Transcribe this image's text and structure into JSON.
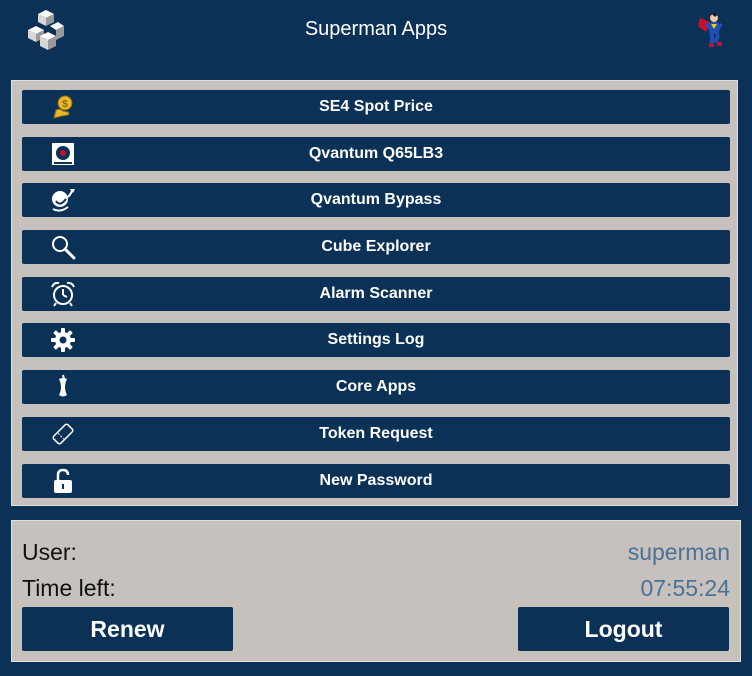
{
  "header": {
    "title": "Superman Apps",
    "logo_icon": "cubes-logo-icon",
    "avatar_icon": "superman-avatar-icon"
  },
  "menu": {
    "items": [
      {
        "label": "SE4 Spot Price",
        "icon": "coin-hand-icon"
      },
      {
        "label": "Qvantum Q65LB3",
        "icon": "qvantum-badge-icon"
      },
      {
        "label": "Qvantum Bypass",
        "icon": "bypass-arrow-icon"
      },
      {
        "label": "Cube Explorer",
        "icon": "magnifier-icon"
      },
      {
        "label": "Alarm Scanner",
        "icon": "alarm-clock-icon"
      },
      {
        "label": "Settings Log",
        "icon": "gear-icon"
      },
      {
        "label": "Core Apps",
        "icon": "apple-core-icon"
      },
      {
        "label": "Token Request",
        "icon": "ticket-icon"
      },
      {
        "label": "New Password",
        "icon": "unlock-icon"
      }
    ]
  },
  "session": {
    "user_label": "User:",
    "user_value": "superman",
    "time_label": "Time left:",
    "time_value": "07:55:24",
    "renew_label": "Renew",
    "logout_label": "Logout"
  },
  "colors": {
    "background": "#0b3157",
    "panel": "#c6c1bd",
    "value_text": "#4b7196",
    "accent_gold": "#e8b72a"
  }
}
